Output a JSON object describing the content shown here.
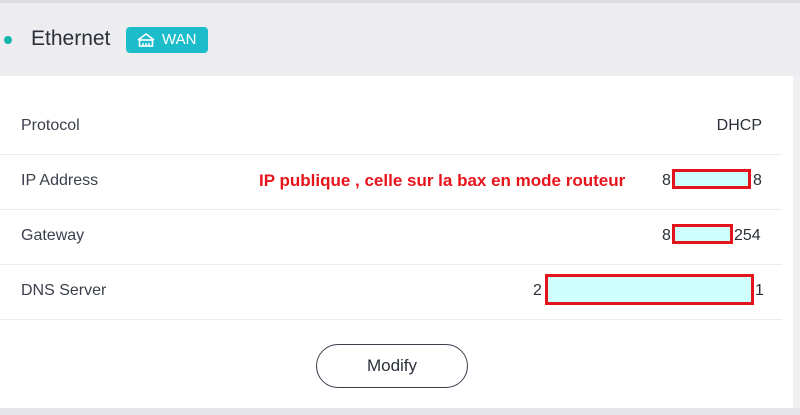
{
  "header": {
    "title": "Ethernet",
    "badge_label": "WAN",
    "badge_icon": "network-icon",
    "status_color": "#18b6a8",
    "badge_color": "#1cbccb"
  },
  "rows": [
    {
      "label": "Protocol",
      "value": "DHCP"
    },
    {
      "label": "IP Address",
      "prefix": "8",
      "suffix": "8",
      "annotation": "IP publique , celle sur la bax en mode routeur"
    },
    {
      "label": "Gateway",
      "prefix": "8",
      "suffix": "254"
    },
    {
      "label": "DNS Server",
      "prefix": "2",
      "suffix": "1"
    }
  ],
  "actions": {
    "modify_label": "Modify"
  },
  "colors": {
    "annotation": "#e8141c",
    "mask_fill": "#cffffd",
    "mask_border": "#e3141c"
  }
}
